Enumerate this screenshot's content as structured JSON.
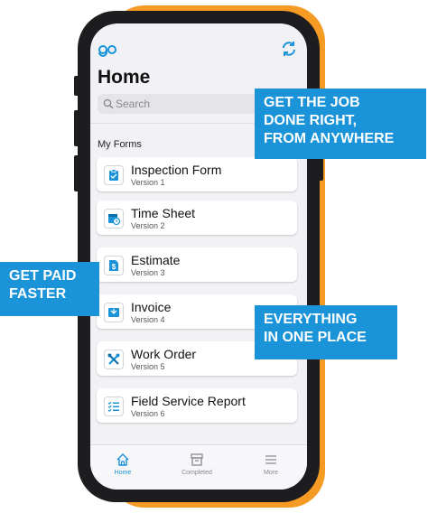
{
  "app": {
    "title": "Home",
    "logo": "go"
  },
  "search": {
    "placeholder": "Search"
  },
  "section_title": "My Forms",
  "forms": [
    {
      "name": "Inspection Form",
      "version": "Version 1",
      "icon": "clipboard-icon"
    },
    {
      "name": "Time Sheet",
      "version": "Version 2",
      "icon": "calendar-clock-icon"
    },
    {
      "name": "Estimate",
      "version": "Version 3",
      "icon": "dollar-document-icon"
    },
    {
      "name": "Invoice",
      "version": "Version 4",
      "icon": "invoice-icon"
    },
    {
      "name": "Work Order",
      "version": "Version 5",
      "icon": "tools-icon"
    },
    {
      "name": "Field Service Report",
      "version": "Version 6",
      "icon": "checklist-icon"
    }
  ],
  "tabbar": {
    "home": "Home",
    "completed": "Completed",
    "more": "More"
  },
  "callouts": {
    "top": [
      "GET THE JOB",
      "DONE RIGHT,",
      "FROM ANYWHERE"
    ],
    "left": [
      "GET PAID",
      "FASTER"
    ],
    "bottom": [
      "EVERYTHING",
      "IN ONE PLACE"
    ]
  },
  "colors": {
    "accent": "#1a93d8",
    "orange": "#f59a23",
    "phone": "#1d1d1f"
  }
}
